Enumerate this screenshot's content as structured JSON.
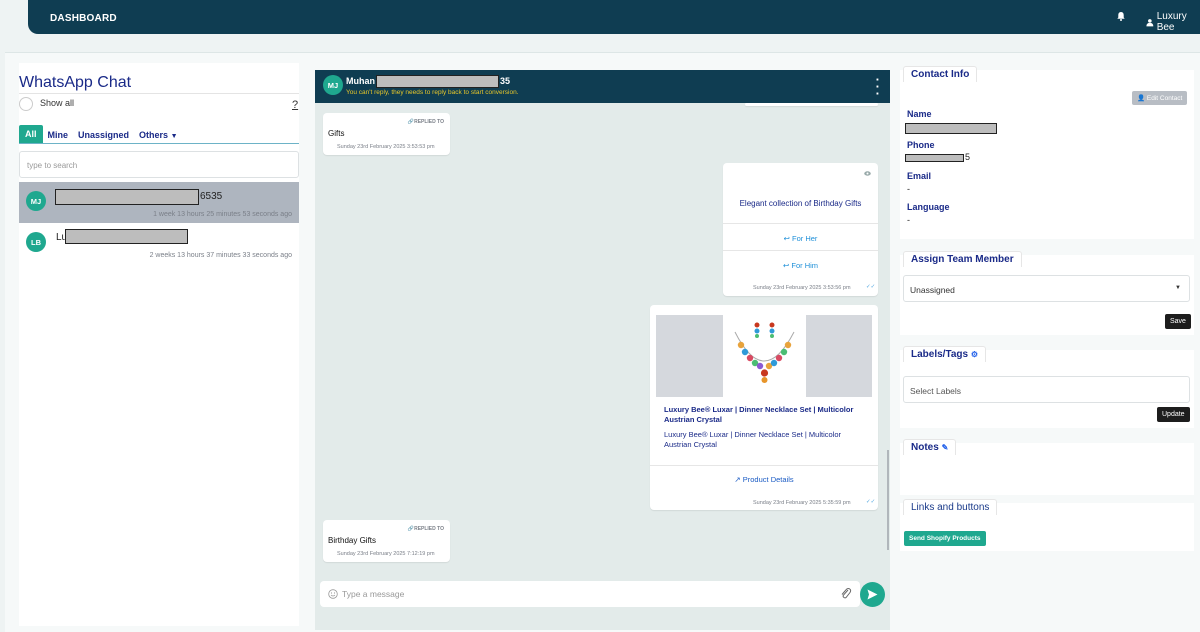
{
  "topbar": {
    "brand": "DASHBOARD",
    "user": "Luxury Bee"
  },
  "left": {
    "title": "WhatsApp Chat",
    "show_all": "Show all",
    "help": "?",
    "tabs": [
      "All",
      "Mine",
      "Unassigned",
      "Others"
    ],
    "search_placeholder": "type to search",
    "chats": [
      {
        "avatar": "MJ",
        "name_suffix": "6535",
        "time": "1 week 13 hours 25 minutes 53 seconds ago",
        "selected": true
      },
      {
        "avatar": "LB",
        "name_prefix": "Lu",
        "time": "2 weeks 13 hours 37 minutes 33 seconds ago",
        "selected": false
      }
    ]
  },
  "chat": {
    "avatar": "MJ",
    "name_prefix": "Muhan",
    "name_suffix": "35",
    "notice": "You can't reply, they needs to reply back to start conversion.",
    "messages": {
      "m1": {
        "tag": "REPLIED TO",
        "text": "Gifts",
        "time": "Sunday 23rd February 2025 3:53:53 pm"
      },
      "m2": {
        "text": "Elegant collection of Birthday Gifts",
        "btn1": "For Her",
        "btn2": "For Him",
        "time": "Sunday 23rd February 2025 3:53:56 pm"
      },
      "m3": {
        "title": "Luxury Bee® Luxar | Dinner Necklace Set | Multicolor Austrian Crystal",
        "desc": "Luxury Bee® Luxar | Dinner Necklace Set | Multicolor Austrian Crystal",
        "btn": "Product Details",
        "time": "Sunday 23rd February 2025 5:35:59 pm"
      },
      "m4": {
        "tag": "REPLIED TO",
        "text": "Birthday Gifts",
        "time": "Sunday 23rd February 2025 7:12:19 pm"
      }
    },
    "composer_placeholder": "Type a message"
  },
  "right": {
    "contact_info": "Contact Info",
    "edit_contact": "Edit Contact",
    "name_label": "Name",
    "phone_label": "Phone",
    "phone_suffix": "5",
    "email_label": "Email",
    "email_value": "-",
    "language_label": "Language",
    "language_value": "-",
    "assign_title": "Assign Team Member",
    "assign_value": "Unassigned",
    "save": "Save",
    "labels_title": "Labels/Tags",
    "labels_placeholder": "Select Labels",
    "update": "Update",
    "notes_title": "Notes",
    "links_title": "Links and buttons",
    "shopify_btn": "Send Shopify Products"
  },
  "colors": {
    "header": "#0f3d52",
    "accent": "#1fa88f",
    "notice": "#e7c72a",
    "link": "#1e8fd8"
  }
}
